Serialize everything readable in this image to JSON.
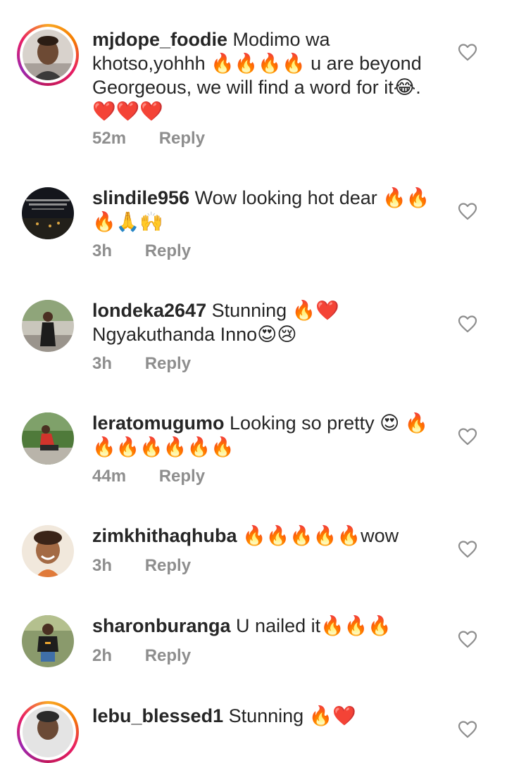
{
  "comments": [
    {
      "username": "mjdope_foodie",
      "text": "Modimo wa khotso,yohhh 🔥🔥🔥🔥 u are beyond Georgeous, we will find a word for it😂. ❤️❤️❤️",
      "time": "52m",
      "reply_label": "Reply"
    },
    {
      "username": "slindile956",
      "text": "Wow looking hot dear 🔥🔥🔥🙏🙌",
      "time": "3h",
      "reply_label": "Reply"
    },
    {
      "username": "londeka2647",
      "text": "Stunning 🔥❤️ Ngyakuthanda Inno😍😢",
      "time": "3h",
      "reply_label": "Reply"
    },
    {
      "username": "leratomugumo",
      "text": "Looking so pretty 😍 🔥🔥🔥🔥🔥🔥🔥",
      "time": "44m",
      "reply_label": "Reply"
    },
    {
      "username": "zimkhithaqhuba",
      "text": "🔥🔥🔥🔥🔥wow",
      "time": "3h",
      "reply_label": "Reply"
    },
    {
      "username": "sharonburanga",
      "text": "U nailed it🔥🔥🔥",
      "time": "2h",
      "reply_label": "Reply"
    },
    {
      "username": "lebu_blessed1",
      "text": "Stunning 🔥❤️",
      "time": "",
      "reply_label": ""
    }
  ],
  "icons": {
    "like": "heart-outline-icon"
  },
  "colors": {
    "text": "#262626",
    "meta": "#8e8e8e",
    "heart_outline": "#8e8e8e"
  }
}
